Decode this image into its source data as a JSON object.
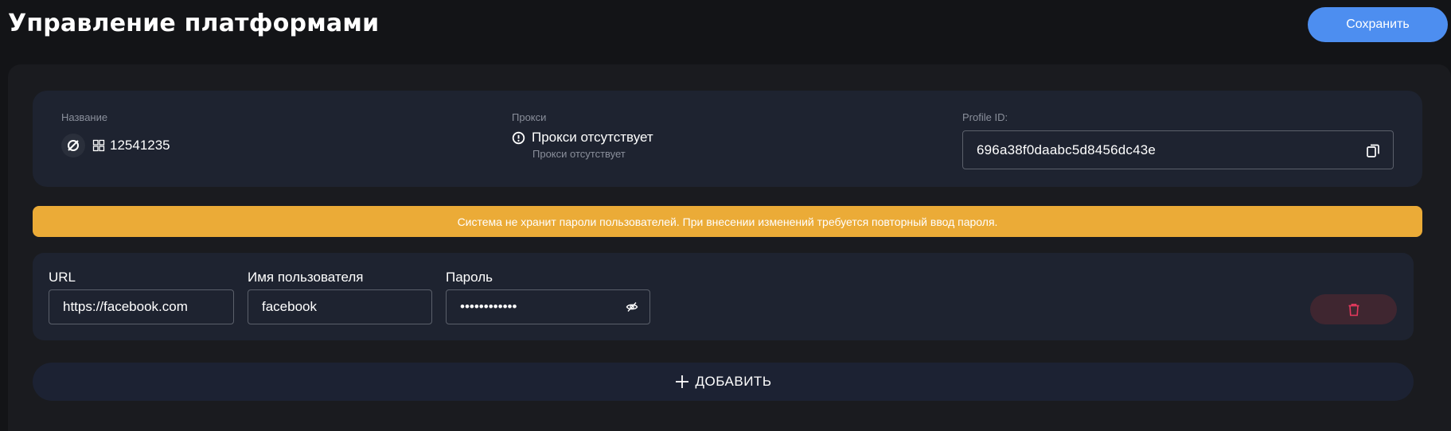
{
  "header": {
    "title": "Управление платформами",
    "save_label": "Сохранить"
  },
  "profile": {
    "name_label": "Название",
    "name_value": "12541235",
    "platform_icon": "no-platform-icon",
    "os_icon": "windows-icon",
    "proxy_label": "Прокси",
    "proxy_status": "Прокси отсутствует",
    "proxy_substatus": "Прокси отсутствует",
    "proxy_icon": "alert-circle-icon",
    "profile_id_label": "Profile ID:",
    "profile_id_value": "696a38f0daabc5d8456dc43e",
    "copy_icon": "copy-icon"
  },
  "warning": {
    "text": "Система не хранит пароли пользователей. При внесении изменений требуется повторный ввод пароля.",
    "color": "#ebab37"
  },
  "credentials": {
    "url_label": "URL",
    "url_value": "https://facebook.com",
    "username_label": "Имя пользователя",
    "username_value": "facebook",
    "password_label": "Пароль",
    "password_value": "aaaaaaaaaaaa",
    "eye_icon": "eye-off-icon",
    "delete_icon": "trash-icon"
  },
  "add_label": "ДОБАВИТЬ",
  "colors": {
    "accent": "#4d8ef0",
    "danger": "#e5395d",
    "background": "#131417",
    "card": "#1e2330"
  }
}
